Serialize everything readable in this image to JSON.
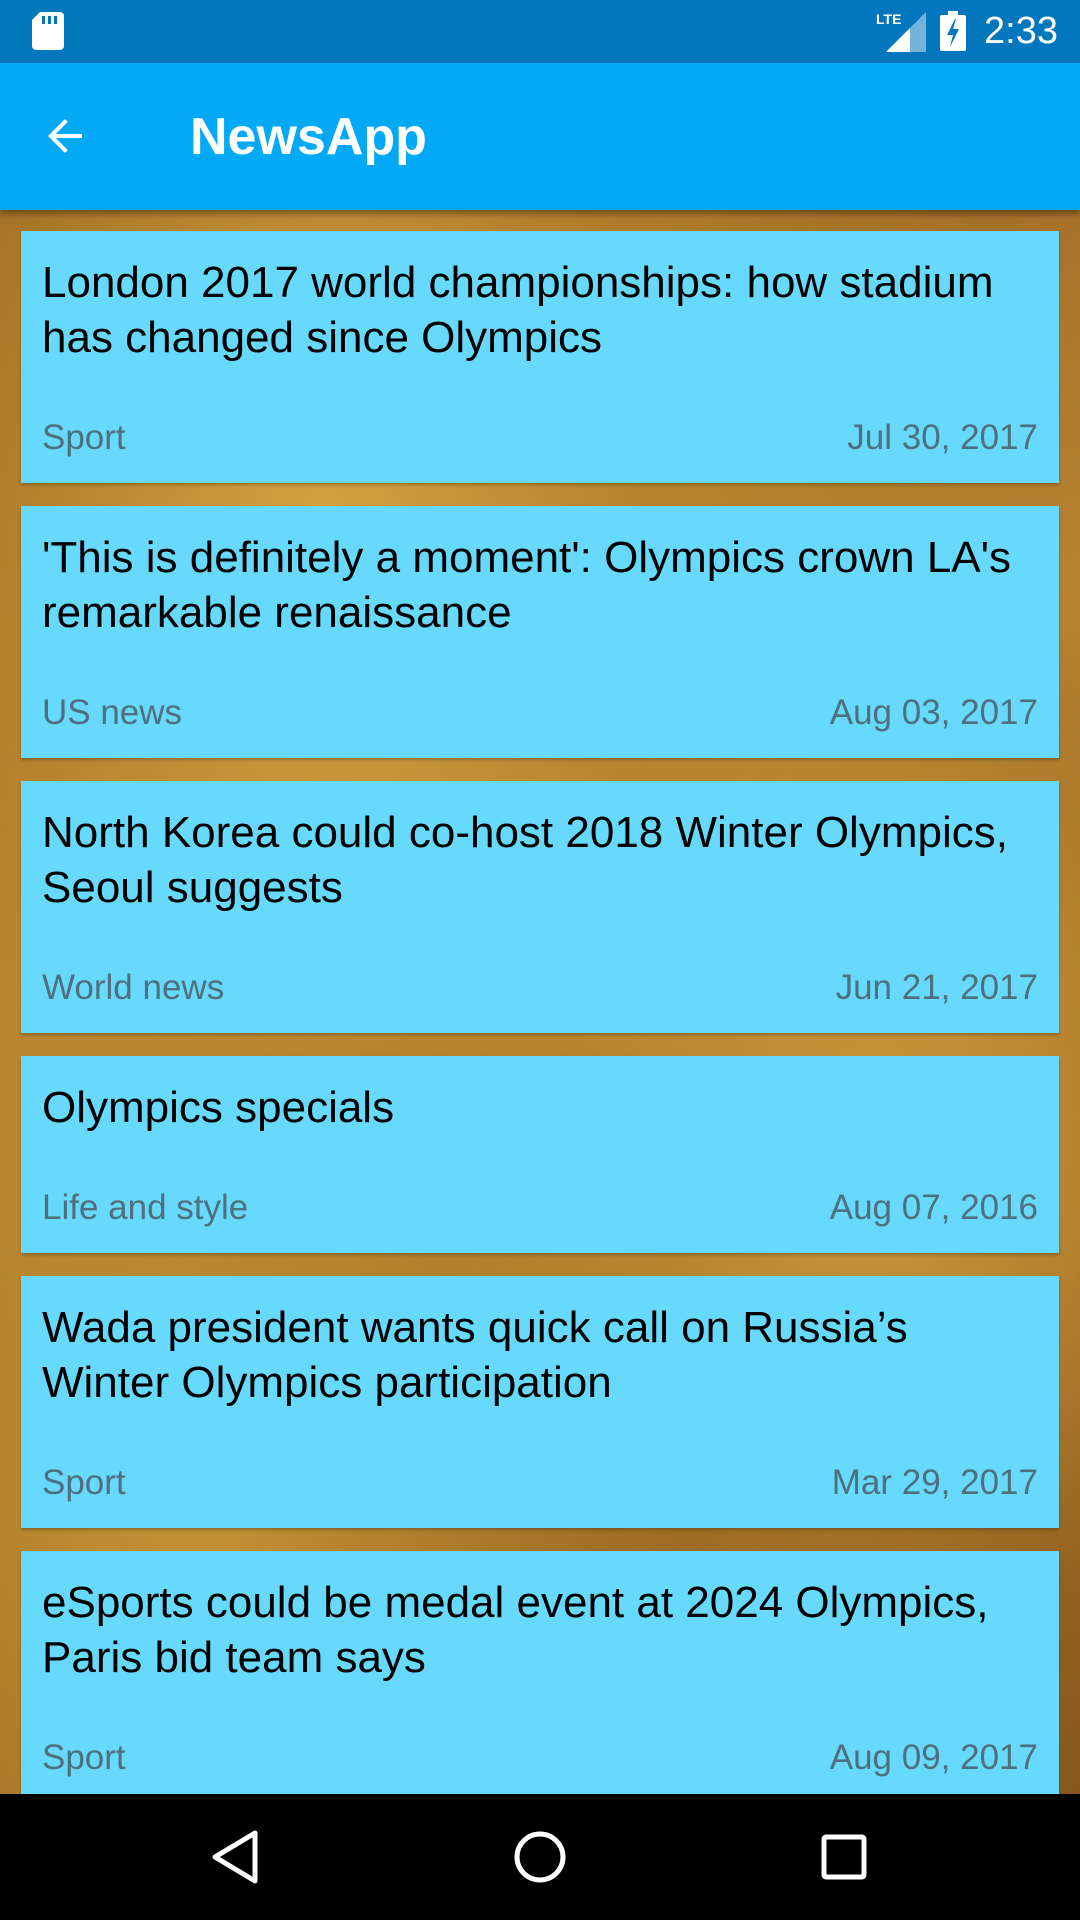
{
  "status_bar": {
    "network": "LTE",
    "time": "2:33",
    "icons": [
      "sd-card-icon",
      "lte-signal-icon",
      "battery-charging-icon"
    ]
  },
  "app_bar": {
    "title": "NewsApp",
    "back_icon": "arrow-back-icon"
  },
  "articles": [
    {
      "title": "London 2017 world championships: how stadium has changed since Olympics",
      "section": "Sport",
      "date": "Jul 30, 2017"
    },
    {
      "title": "'This is definitely a moment': Olympics crown LA's remarkable renaissance",
      "section": "US news",
      "date": "Aug 03, 2017"
    },
    {
      "title": "North Korea could co-host 2018 Winter Olympics, Seoul suggests",
      "section": "World news",
      "date": "Jun 21, 2017"
    },
    {
      "title": "Olympics specials",
      "section": "Life and style",
      "date": "Aug 07, 2016"
    },
    {
      "title": "Wada president wants quick call on Russia’s Winter Olympics participation",
      "section": "Sport",
      "date": "Mar 29, 2017"
    },
    {
      "title": "eSports could be medal event at 2024 Olympics, Paris bid team says",
      "section": "Sport",
      "date": "Aug 09, 2017"
    }
  ],
  "nav_bar": {
    "icons": [
      "back-triangle-icon",
      "home-circle-icon",
      "recents-square-icon"
    ]
  },
  "colors": {
    "status_bar": "#0277bd",
    "app_bar": "#03a9f4",
    "card": "#67d9fd",
    "meta_text": "#4f6f7c"
  }
}
